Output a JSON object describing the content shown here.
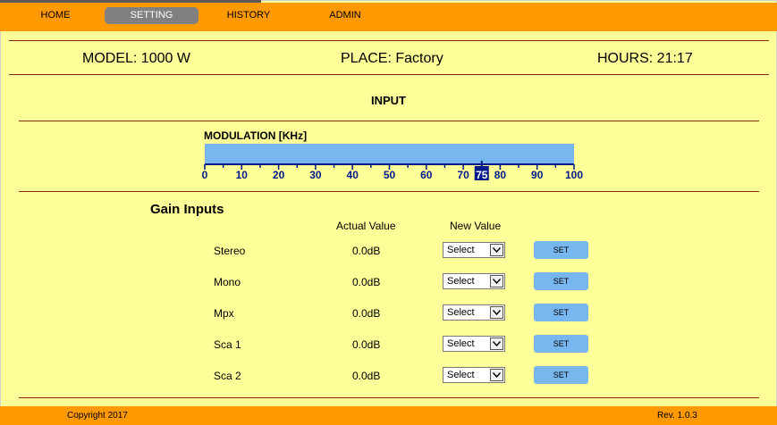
{
  "nav": {
    "items": [
      {
        "label": "HOME"
      },
      {
        "label": "SETTING"
      },
      {
        "label": "HISTORY"
      },
      {
        "label": "ADMIN"
      }
    ],
    "active": "SETTING"
  },
  "info": {
    "model": "MODEL: 1000 W",
    "place": "PLACE: Factory",
    "hours": "HOURS: 21:17"
  },
  "section_title": "INPUT",
  "modulation": {
    "label": "MODULATION [KHz]",
    "value": 75,
    "min": 0,
    "max": 100,
    "ticks": [
      "0",
      "10",
      "20",
      "30",
      "40",
      "50",
      "60",
      "70",
      "75",
      "80",
      "90",
      "100"
    ],
    "bar_color": "#78b6f0",
    "scale_color": "#001a8c"
  },
  "gain": {
    "title": "Gain Inputs",
    "col_actual": "Actual Value",
    "col_new": "New Value",
    "rows": [
      {
        "label": "Stereo",
        "actual": "0.0dB",
        "select": "Select",
        "button": "SET"
      },
      {
        "label": "Mono",
        "actual": "0.0dB",
        "select": "Select",
        "button": "SET"
      },
      {
        "label": "Mpx",
        "actual": "0.0dB",
        "select": "Select",
        "button": "SET"
      },
      {
        "label": "Sca 1",
        "actual": "0.0dB",
        "select": "Select",
        "button": "SET"
      },
      {
        "label": "Sca 2",
        "actual": "0.0dB",
        "select": "Select",
        "button": "SET"
      }
    ]
  },
  "footer": {
    "copyright": "Copyright 2017",
    "revision": "Rev. 1.0.3"
  },
  "colors": {
    "page_bg": "#ffff99",
    "nav_bg": "#ff9900",
    "active_tab": "#808080",
    "divider": "#8b2a0a",
    "button": "#78b6f0"
  }
}
